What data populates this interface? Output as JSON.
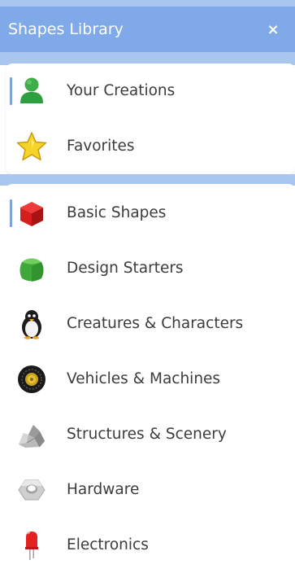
{
  "header": {
    "title": "Shapes Library",
    "close_label": "×"
  },
  "top_items": [
    {
      "label": "Your Creations",
      "icon": "user-icon",
      "selected": true
    },
    {
      "label": "Favorites",
      "icon": "star-icon",
      "selected": false
    }
  ],
  "library_items": [
    {
      "label": "Basic Shapes",
      "icon": "red-cube-icon",
      "selected": true
    },
    {
      "label": "Design Starters",
      "icon": "green-cube-icon",
      "selected": false
    },
    {
      "label": "Creatures & Characters",
      "icon": "penguin-icon",
      "selected": false
    },
    {
      "label": "Vehicles & Machines",
      "icon": "wheel-icon",
      "selected": false
    },
    {
      "label": "Structures & Scenery",
      "icon": "rock-icon",
      "selected": false
    },
    {
      "label": "Hardware",
      "icon": "hex-nut-icon",
      "selected": false
    },
    {
      "label": "Electronics",
      "icon": "led-icon",
      "selected": false
    }
  ],
  "colors": {
    "header": "#7fa9e8",
    "band": "#a9c6ee",
    "selection_bar": "#7fa3d6",
    "text": "#3c3c3c"
  }
}
